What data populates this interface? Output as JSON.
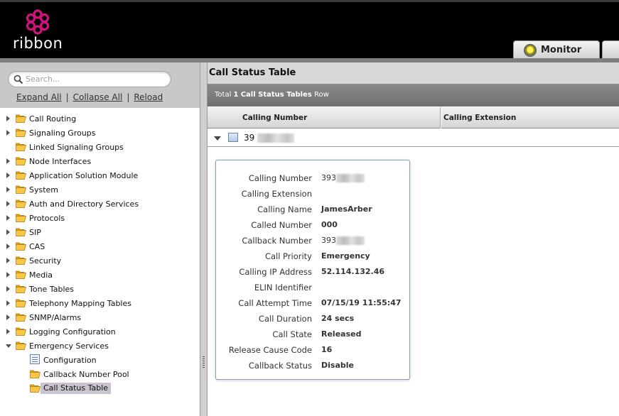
{
  "brand": {
    "name": "ribbon",
    "accent": "#d1127a"
  },
  "header": {
    "tabs": [
      {
        "label": "Monitor",
        "icon": "status-lamp-icon",
        "lamp_color": "#f5e616"
      }
    ]
  },
  "sidebar": {
    "search": {
      "placeholder": "Search..."
    },
    "links": {
      "expand_all": "Expand All",
      "collapse_all": "Collapse All",
      "reload": "Reload",
      "separator": "|"
    },
    "tree": [
      {
        "label": "Call Routing",
        "expandable": true
      },
      {
        "label": "Signaling Groups",
        "expandable": true
      },
      {
        "label": "Linked Signaling Groups",
        "expandable": false
      },
      {
        "label": "Node Interfaces",
        "expandable": true
      },
      {
        "label": "Application Solution Module",
        "expandable": true
      },
      {
        "label": "System",
        "expandable": true
      },
      {
        "label": "Auth and Directory Services",
        "expandable": true
      },
      {
        "label": "Protocols",
        "expandable": true
      },
      {
        "label": "SIP",
        "expandable": true
      },
      {
        "label": "CAS",
        "expandable": true
      },
      {
        "label": "Security",
        "expandable": true
      },
      {
        "label": "Media",
        "expandable": true
      },
      {
        "label": "Tone Tables",
        "expandable": true
      },
      {
        "label": "Telephony Mapping Tables",
        "expandable": true
      },
      {
        "label": "SNMP/Alarms",
        "expandable": true
      },
      {
        "label": "Logging Configuration",
        "expandable": true
      },
      {
        "label": "Emergency Services",
        "expandable": true,
        "expanded": true,
        "children": [
          {
            "label": "Configuration",
            "icon": "config-table-icon"
          },
          {
            "label": "Callback Number Pool",
            "icon": "folder-icon"
          },
          {
            "label": "Call Status Table",
            "icon": "folder-icon",
            "selected": true
          }
        ]
      }
    ]
  },
  "main": {
    "title": "Call Status Table",
    "summary": {
      "prefix": "Total",
      "count": "1",
      "table_name": "Call Status Tables",
      "suffix": "Row"
    },
    "columns": [
      "Calling Number",
      "Calling Extension"
    ],
    "rows": [
      {
        "calling_number_visible": "39",
        "redacted": true
      }
    ],
    "details": [
      {
        "label": "Calling Number",
        "value": "393",
        "redacted": true
      },
      {
        "label": "Calling Extension",
        "value": ""
      },
      {
        "label": "Calling Name",
        "value": "JamesArber"
      },
      {
        "label": "Called Number",
        "value": "000"
      },
      {
        "label": "Callback Number",
        "value": "393",
        "redacted": true
      },
      {
        "label": "Call Priority",
        "value": "Emergency"
      },
      {
        "label": "Calling IP Address",
        "value": "52.114.132.46"
      },
      {
        "label": "ELIN Identifier",
        "value": ""
      },
      {
        "label": "Call Attempt Time",
        "value": "07/15/19 11:55:47"
      },
      {
        "label": "Call Duration",
        "value": "24 secs"
      },
      {
        "label": "Call State",
        "value": "Released"
      },
      {
        "label": "Release Cause Code",
        "value": "16"
      },
      {
        "label": "Callback Status",
        "value": "Disable"
      }
    ]
  }
}
